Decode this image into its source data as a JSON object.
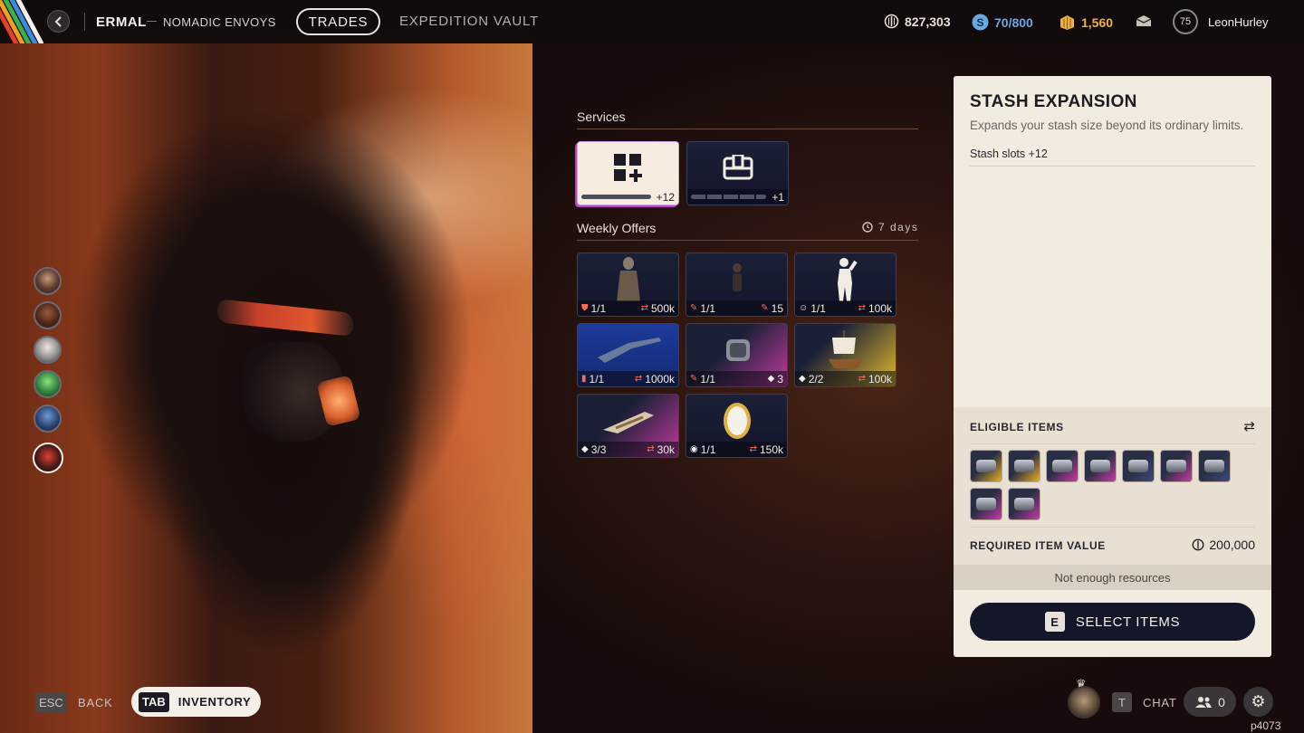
{
  "topbar": {
    "vendor_name": "ERMAL",
    "vendor_faction": "NOMADIC ENVOYS",
    "tabs": [
      {
        "label": "TRADES",
        "active": true
      },
      {
        "label": "EXPEDITION VAULT",
        "active": false
      }
    ],
    "currencies": [
      {
        "icon": "credits-icon",
        "value": "827,303",
        "color": "#e8e0d4"
      },
      {
        "icon": "tokens-icon",
        "value": "70/800",
        "color": "#6aa8e0"
      },
      {
        "icon": "premium-icon",
        "value": "1,560",
        "color": "#f0b040"
      }
    ],
    "player": {
      "level": "75",
      "name": "LeonHurley"
    }
  },
  "services": {
    "title": "Services",
    "items": [
      {
        "icon": "grid-plus-icon",
        "badge": "+12",
        "selected": true
      },
      {
        "icon": "chest-icon",
        "badge": "+1",
        "selected": false
      }
    ]
  },
  "weekly": {
    "title": "Weekly Offers",
    "timer": "7 days",
    "offers": [
      {
        "art": "cloaked-figure",
        "left": "1/1",
        "right": "500k",
        "left_icon": "armor-icon",
        "right_icon": "swap-icon",
        "accent": "#1c2036"
      },
      {
        "art": "small-figure",
        "left": "1/1",
        "right": "15",
        "left_icon": "wrench-icon",
        "right_icon": "wrench-icon",
        "accent": "#1c2036"
      },
      {
        "art": "white-pose",
        "left": "1/1",
        "right": "100k",
        "left_icon": "emote-icon",
        "right_icon": "swap-icon",
        "accent": "#1c2036"
      },
      {
        "art": "blueprint-rifle",
        "left": "1/1",
        "right": "1000k",
        "left_icon": "book-icon",
        "right_icon": "swap-icon",
        "accent": "#1a2a6a"
      },
      {
        "art": "metal-part",
        "left": "1/1",
        "right": "3",
        "left_icon": "wrench-icon",
        "right_icon": "gem-icon",
        "accent": "#c03aa0"
      },
      {
        "art": "galleon-ship",
        "left": "2/2",
        "right": "100k",
        "left_icon": "gem-icon",
        "right_icon": "swap-icon",
        "accent": "#e0b82a"
      },
      {
        "art": "speeder-bike",
        "left": "3/3",
        "right": "30k",
        "left_icon": "gem-icon",
        "right_icon": "swap-icon",
        "accent": "#c03aa0"
      },
      {
        "art": "egg-shield",
        "left": "1/1",
        "right": "150k",
        "left_icon": "credits-icon",
        "right_icon": "swap-icon",
        "accent": "#1c2036"
      }
    ]
  },
  "info_panel": {
    "title": "STASH EXPANSION",
    "description": "Expands your stash size beyond its ordinary limits.",
    "stat": "Stash slots +12",
    "eligible_label": "ELIGIBLE ITEMS",
    "eligible_items": [
      {
        "accent": "#e8b020"
      },
      {
        "accent": "#e8b020"
      },
      {
        "accent": "#c83aa8"
      },
      {
        "accent": "#c83aa8"
      },
      {
        "accent": "#3a4a7a"
      },
      {
        "accent": "#c83aa8"
      },
      {
        "accent": "#3a4a7a"
      },
      {
        "accent": "#c83aa8"
      },
      {
        "accent": "#c83aa8"
      }
    ],
    "required_label": "REQUIRED ITEM VALUE",
    "required_value": "200,000",
    "status": "Not enough resources",
    "button_key": "E",
    "button_label": "SELECT ITEMS"
  },
  "bottom": {
    "esc_key": "ESC",
    "back_label": "BACK",
    "tab_key": "TAB",
    "inventory_label": "INVENTORY",
    "chat_key": "T",
    "chat_label": "CHAT",
    "friends_count": "0",
    "build_id": "p4073"
  }
}
